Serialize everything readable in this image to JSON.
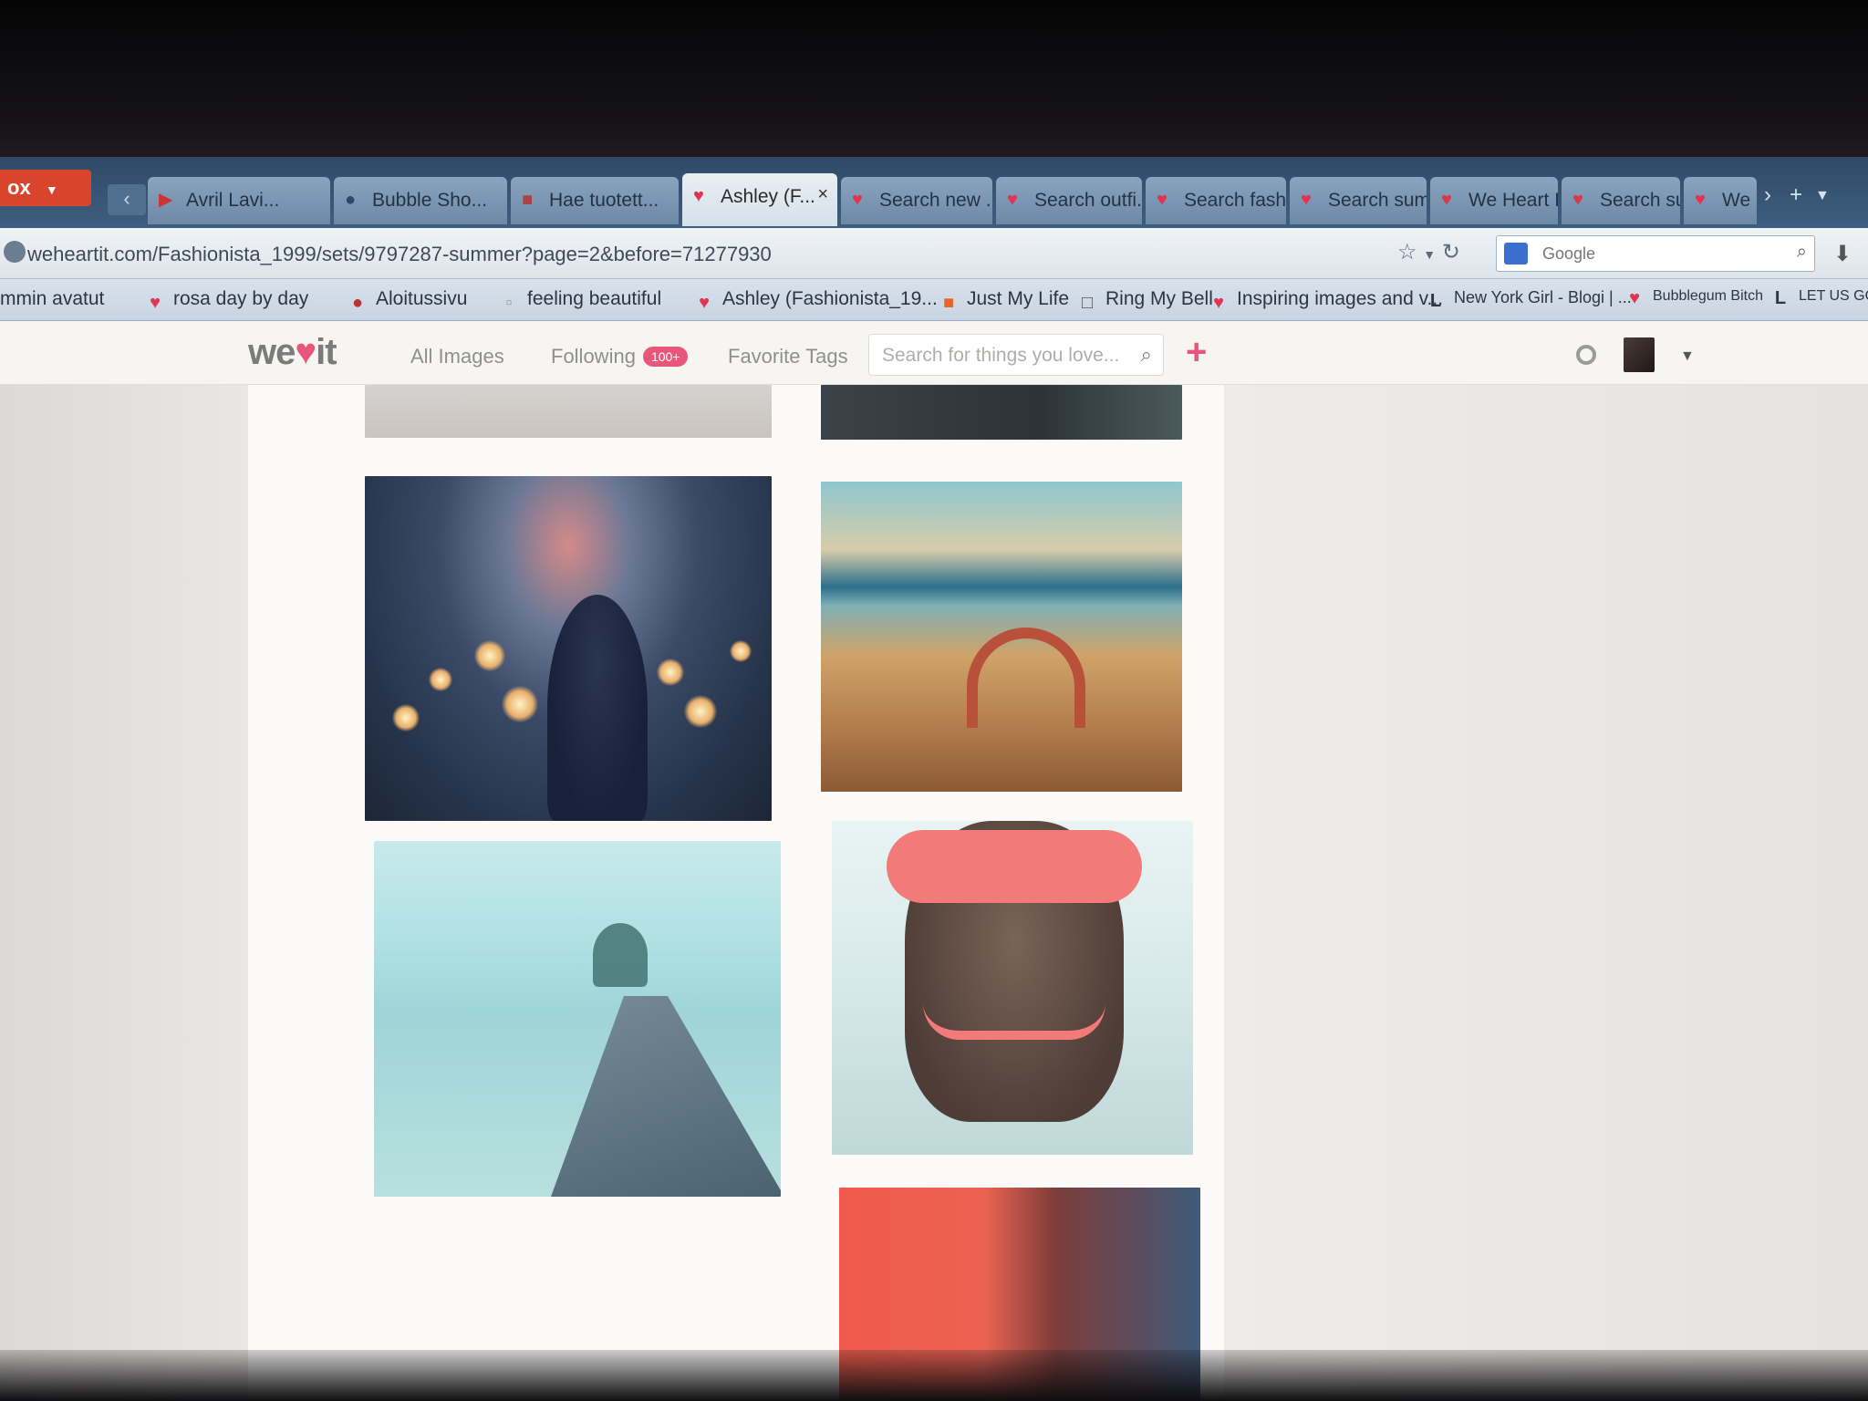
{
  "browser": {
    "menu_button_label": "ox",
    "tabs": [
      {
        "label": "Avril Lavi...",
        "icon": "youtube-icon"
      },
      {
        "label": "Bubble Sho...",
        "icon": "game-icon"
      },
      {
        "label": "Hae tuotett...",
        "icon": "shop-icon"
      },
      {
        "label": "Ashley (F...",
        "icon": "heart-icon",
        "active": true
      },
      {
        "label": "Search new ...",
        "icon": "heart-icon"
      },
      {
        "label": "Search outfi...",
        "icon": "heart-icon"
      },
      {
        "label": "Search fashi...",
        "icon": "heart-icon"
      },
      {
        "label": "Search sum...",
        "icon": "heart-icon"
      },
      {
        "label": "We Heart It",
        "icon": "heart-icon"
      },
      {
        "label": "Search sum...",
        "icon": "heart-icon"
      },
      {
        "label": "We H...",
        "icon": "heart-icon"
      }
    ],
    "url": "weheartit.com/Fashionista_1999/sets/9797287-summer?page=2&before=71277930",
    "search_engine_placeholder": "Google",
    "bookmarks": [
      {
        "label": "mmin avatut",
        "icon": "globe-icon"
      },
      {
        "label": "rosa day by day",
        "icon": "heart-icon"
      },
      {
        "label": "Aloitussivu",
        "icon": "globe-icon"
      },
      {
        "label": "feeling beautiful",
        "icon": "page-icon"
      },
      {
        "label": "Ashley (Fashionista_19...",
        "icon": "heart-icon"
      },
      {
        "label": "Just My Life",
        "icon": "blogger-icon"
      },
      {
        "label": "Ring My Bell",
        "icon": "page-icon"
      },
      {
        "label": "Inspiring images and v...",
        "icon": "heart-icon"
      },
      {
        "label": "New York Girl - Blogi | ...",
        "icon": "letter-l-icon"
      },
      {
        "label": "Bubblegum Bitch",
        "icon": "heart-icon"
      },
      {
        "label": "LET US GO",
        "icon": "letter-l-icon"
      }
    ]
  },
  "site": {
    "logo_prefix": "we",
    "logo_suffix": "it",
    "nav": {
      "all_images": "All Images",
      "following": "Following",
      "following_badge": "100+",
      "favorite_tags": "Favorite Tags"
    },
    "search_placeholder": "Search for things you love...",
    "add_button": "+",
    "accent_color": "#e8577a"
  }
}
